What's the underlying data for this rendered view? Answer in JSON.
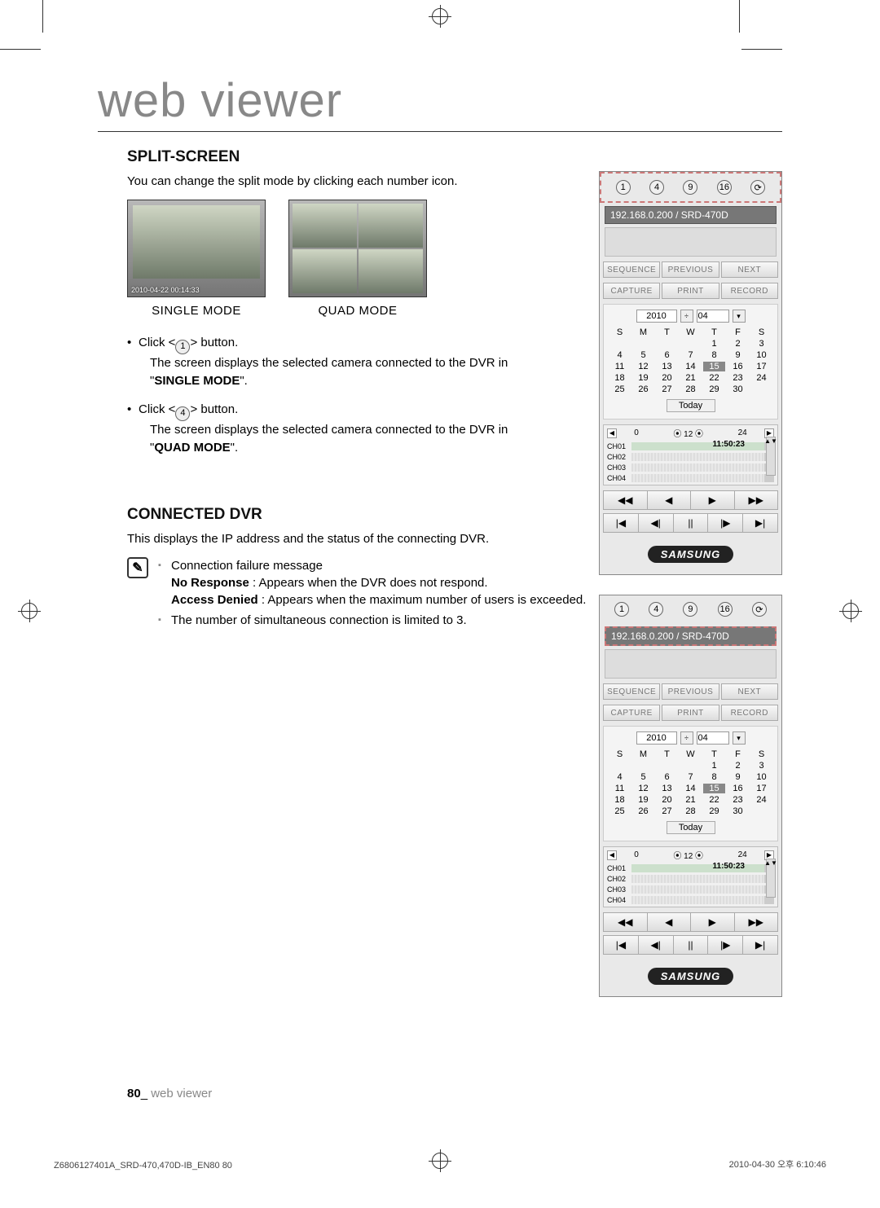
{
  "page": {
    "title": "web viewer",
    "footer_num": "80",
    "footer_sep": "_",
    "footer_section": "web viewer"
  },
  "split_screen": {
    "heading": "SPLIT-SCREEN",
    "intro": "You can change the split mode by clicking each number icon.",
    "single_thumb_ts": "2010-04-22 00:14:33",
    "single_label": "SINGLE MODE",
    "quad_label": "QUAD MODE",
    "bullet1_pre": "Click <",
    "bullet1_num": "1",
    "bullet1_post": "> button.",
    "bullet1_sub_a": "The screen displays the selected camera connected to the DVR in",
    "bullet1_mode_open": "\"",
    "bullet1_mode": "SINGLE MODE",
    "bullet1_mode_close": "\".",
    "bullet2_pre": "Click <",
    "bullet2_num": "4",
    "bullet2_post": "> button.",
    "bullet2_sub_a": "The screen displays the selected camera connected to the DVR in",
    "bullet2_mode": "QUAD MODE"
  },
  "connected_dvr": {
    "heading": "CONNECTED DVR",
    "intro": "This displays the IP address and the status of the connecting DVR.",
    "note_icon": "✎",
    "notes": {
      "n1_title": "Connection failure message",
      "n1_l1_b": "No Response",
      "n1_l1_t": " : Appears when the DVR does not respond.",
      "n1_l2_b": "Access Denied",
      "n1_l2_t": " : Appears when the maximum number of users is exceeded.",
      "n2": "The number of simultaneous connection is limited to 3."
    }
  },
  "panel": {
    "mode_btns": [
      "1",
      "4",
      "9",
      "16"
    ],
    "refresh": "⟳",
    "ip": "192.168.0.200",
    "sep": " / ",
    "model": "SRD-470D",
    "row1": [
      "SEQUENCE",
      "PREVIOUS",
      "NEXT"
    ],
    "row2": [
      "CAPTURE",
      "PRINT",
      "RECORD"
    ],
    "cal": {
      "year": "2010",
      "month": "04",
      "days": [
        "S",
        "M",
        "T",
        "W",
        "T",
        "F",
        "S"
      ],
      "grid": [
        [
          "",
          "",
          "",
          "",
          "1",
          "2",
          "3"
        ],
        [
          "4",
          "5",
          "6",
          "7",
          "8",
          "9",
          "10"
        ],
        [
          "11",
          "12",
          "13",
          "14",
          "15",
          "16",
          "17"
        ],
        [
          "18",
          "19",
          "20",
          "21",
          "22",
          "23",
          "24"
        ],
        [
          "25",
          "26",
          "27",
          "28",
          "29",
          "30",
          ""
        ]
      ],
      "selected": "15",
      "today": "Today"
    },
    "timeline": {
      "start": "0",
      "mid": "12",
      "end": "24",
      "channels": [
        "CH01",
        "CH02",
        "CH03",
        "CH04"
      ],
      "time": "11:50:23"
    },
    "transport": {
      "row1": [
        "◀◀",
        "◀",
        "▶",
        "▶▶"
      ],
      "row2": [
        "|◀",
        "◀|",
        "||",
        "|▶",
        "▶|"
      ]
    },
    "brand": "SAMSUNG"
  },
  "print": {
    "left": "Z6806127401A_SRD-470,470D-IB_EN80   80",
    "right": "2010-04-30   오후 6:10:46"
  }
}
